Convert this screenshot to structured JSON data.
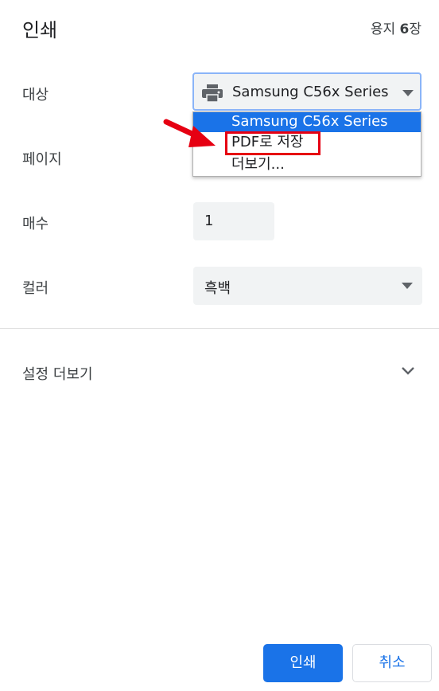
{
  "header": {
    "title": "인쇄",
    "sheets_prefix": "용지 ",
    "sheets_count": "6",
    "sheets_suffix": "장"
  },
  "destination": {
    "label": "대상",
    "selected": "Samsung C56x Series",
    "icon": "printer-icon",
    "options": [
      "Samsung C56x Series",
      "PDF로 저장",
      "더보기..."
    ]
  },
  "pages": {
    "label": "페이지"
  },
  "copies": {
    "label": "매수",
    "value": "1"
  },
  "color": {
    "label": "컬러",
    "value": "흑백"
  },
  "more_settings": {
    "label": "설정 더보기",
    "icon": "chevron-down-icon"
  },
  "buttons": {
    "print": "인쇄",
    "cancel": "취소"
  },
  "colors": {
    "accent": "#1a73e8",
    "highlight": "#e60012",
    "field_bg": "#f1f3f4"
  }
}
